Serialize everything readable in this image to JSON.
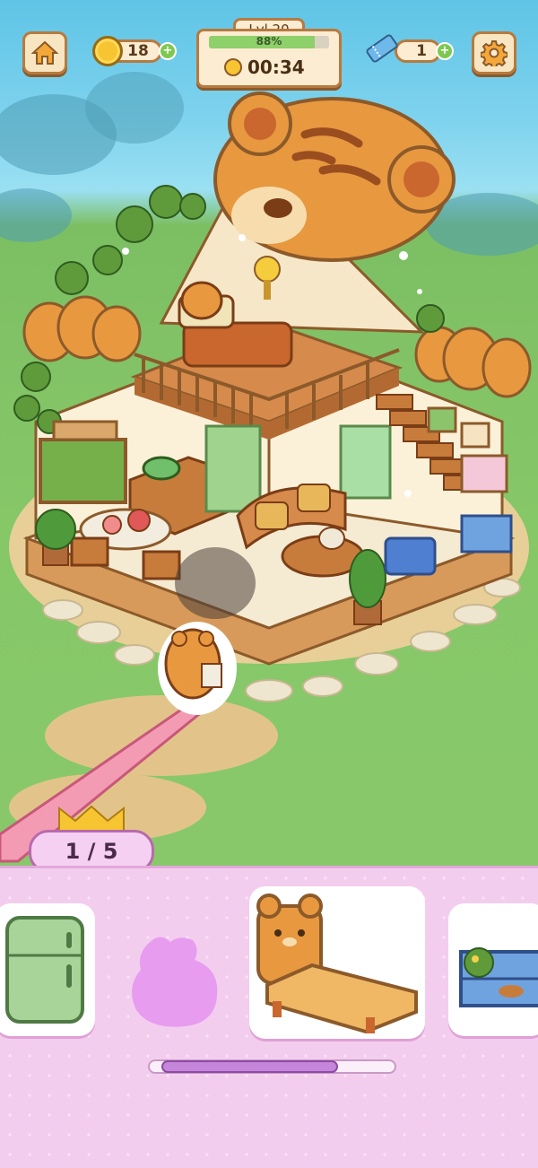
{
  "hud": {
    "home_icon": "home-icon",
    "coins": "18",
    "level_label": "Lvl 20",
    "level_progress_text": "88%",
    "level_progress": 0.88,
    "timer": "00:34",
    "tickets": "1",
    "settings_icon": "gear-icon",
    "plus_symbol": "+"
  },
  "counter": {
    "text": "1 / 5"
  },
  "items_tray": {
    "items": [
      {
        "name": "green-fridge"
      },
      {
        "name": "empty-item-slot"
      },
      {
        "name": "tiger-bed"
      },
      {
        "name": "blue-planter-shelf"
      }
    ],
    "scroll_position": 0.17,
    "scroll_visible_fraction": 0.72
  },
  "colors": {
    "hud_border": "#b77a3e",
    "panel_bg": "#f3cdee",
    "accent_green": "#7ec850"
  }
}
